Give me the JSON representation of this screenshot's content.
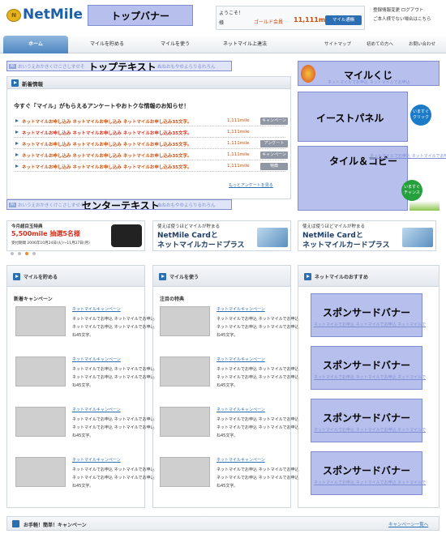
{
  "header": {
    "logo": "NetMile",
    "top_banner": "トップバナー",
    "welcome": "ようこそ！",
    "sama": "様",
    "member_level": "ゴールド会員",
    "miles": "11,111mile",
    "miles_button": "マイル通帳",
    "account_links": [
      "登録情報変更",
      "ログアウト",
      "ご本人様でない場合はこちら"
    ]
  },
  "nav": {
    "tabs": [
      "ホーム",
      "マイルを貯める",
      "マイルを使う",
      "ネットマイル上達法"
    ],
    "utility": [
      "サイトマップ",
      "初めての方へ",
      "お問い合わせ"
    ]
  },
  "top_text": {
    "pr": "PR",
    "faint": "おいうえおかきくけこさしすせそ",
    "faint2": "ぬねおもやゆよらりるれろん",
    "label": "トップテキスト"
  },
  "news": {
    "title": "新着情報",
    "intro": "今すぐ「マイル」がもらえるアンケートやおトクな情報のお知らせ！",
    "rows": [
      {
        "text": "ネットマイルお申し込み ネットマイルお申し込み ネットマイルお申し込み35文字。",
        "miles": "1,111mile",
        "tag": "キャンペーン"
      },
      {
        "text": "ネットマイルお申し込み ネットマイルお申し込み ネットマイルお申し込み35文字。",
        "miles": "1,111mile",
        "tag": ""
      },
      {
        "text": "ネットマイルお申し込み ネットマイルお申し込み ネットマイルお申し込み35文字。",
        "miles": "1,111mile",
        "tag": "アンケート"
      },
      {
        "text": "ネットマイルお申し込み ネットマイルお申し込み ネットマイルお申し込み35文字。",
        "miles": "1,111mile",
        "tag": "キャンペーン"
      },
      {
        "text": "ネットマイルお申し込み ネットマイルお申し込み ネットマイルお申し込み35文字。",
        "miles": "1,111mile",
        "tag": "特典"
      }
    ],
    "more": "もっとアンケートを見る"
  },
  "center_text": {
    "pr": "PR",
    "faint": "おいうえおかきくけこさしすせそ",
    "faint2": "ぬねおもやゆよらりるれろん",
    "label": "センターテキスト"
  },
  "right": {
    "mile_kuji": "マイルくじ",
    "east_panel": "イーストパネル",
    "east_badge": "いますぐ クリック",
    "tile_copy": "タイル＆コピー",
    "tile_badge": "いますぐ チャンス",
    "link_faint": "ネットマイルでお申込 ネットマイルでお申込"
  },
  "promos": [
    {
      "l1": "今月超目玉特典",
      "l2": "5,500mile 抽選5名様",
      "l3": "受付期間 2006年10月24日(火)～11月27日(月)"
    },
    {
      "l1": "使えば使うほどマイルが貯まる",
      "l2": "NetMile Cardと",
      "l3": "ネットマイルカードプラス"
    },
    {
      "l1": "使えば使うほどマイルが貯まる",
      "l2": "NetMile Cardと",
      "l3": "ネットマイルカードプラス"
    }
  ],
  "sections": {
    "earn": {
      "title": "マイルを貯める",
      "sub": "新着キャンペーン"
    },
    "use": {
      "title": "マイルを使う",
      "sub": "注目の特典"
    },
    "recommend": {
      "title": "ネットマイルのおすすめ"
    },
    "item_link": "ネットマイルキャンペーン",
    "item_desc": "ネットマイルでお申込 ネットマイルでお申込 ネットマイルでお申込 ネットマイルでお申込 ね45文字。",
    "sponsored": "スポンサードバナー",
    "sponsored_link": "ネットマイルでお申込 ネットマイルでお申込 ネットマイルでお申込"
  },
  "footer": {
    "title": "お手軽！簡単！キャンペーン",
    "link": "キャンペーン一覧へ"
  }
}
